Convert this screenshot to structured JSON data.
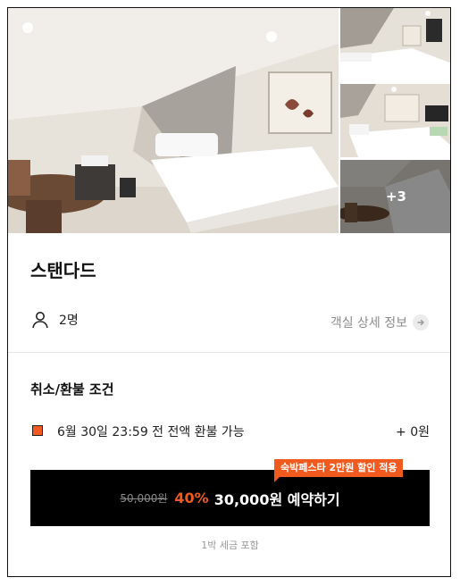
{
  "gallery": {
    "more_count": "+3"
  },
  "room": {
    "name": "스탠다드",
    "guests": "2명",
    "detail_link": "객실 상세 정보"
  },
  "policy": {
    "title": "취소/환불 조건",
    "item_text": "6월 30일 23:59 전 전액 환불 가능",
    "item_amount": "+ 0원"
  },
  "booking": {
    "promo_badge": "숙박페스타 2만원 할인 적용",
    "original_price": "50,000원",
    "discount_rate": "40%",
    "button_label": "30,000원 예약하기",
    "tax_note": "1박 세금 포함"
  },
  "colors": {
    "accent": "#f05a1e",
    "button_bg": "#000000"
  }
}
